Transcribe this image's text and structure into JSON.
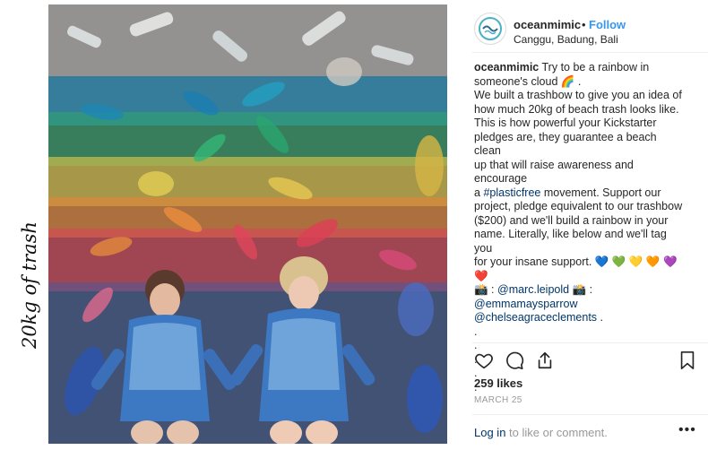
{
  "side_caption": "20kg of trash",
  "post": {
    "username": "oceanmimic",
    "separator": "•",
    "follow_label": "Follow",
    "location": "Canggu, Badung, Bali",
    "caption_lines": [
      "Try to be a rainbow in",
      "someone's cloud 🌈 .",
      "We built a trashbow to give you an idea of",
      "how much 20kg of beach trash looks like.",
      "This is how powerful your Kickstarter",
      "pledges are, they guarantee a beach clean",
      "up that will raise awareness and encourage",
      "a",
      "#plasticfree",
      "movement. Support our",
      "project, pledge equivalent to our trashbow",
      "($200) and we'll build a rainbow in your",
      "name. Literally, like below and we'll tag you",
      "for your insane support. 💙 💚 💛 🧡 💜 ❤️",
      "📸 :",
      "@marc.leipold",
      "📸 :",
      "@emmamaysparrow",
      "@chelseagraceclements",
      "."
    ],
    "dots": [
      ".",
      ".",
      ".",
      ".",
      "."
    ],
    "likes": "259 likes",
    "date": "MARCH 25",
    "login_link": "Log in",
    "login_rest": "to like or comment.",
    "more": "•••"
  },
  "icons": {
    "heart": "heart-icon",
    "comment": "comment-icon",
    "share": "share-icon",
    "bookmark": "bookmark-icon"
  },
  "colors": {
    "follow": "#3897f0",
    "link": "#003569",
    "muted": "#999999"
  }
}
